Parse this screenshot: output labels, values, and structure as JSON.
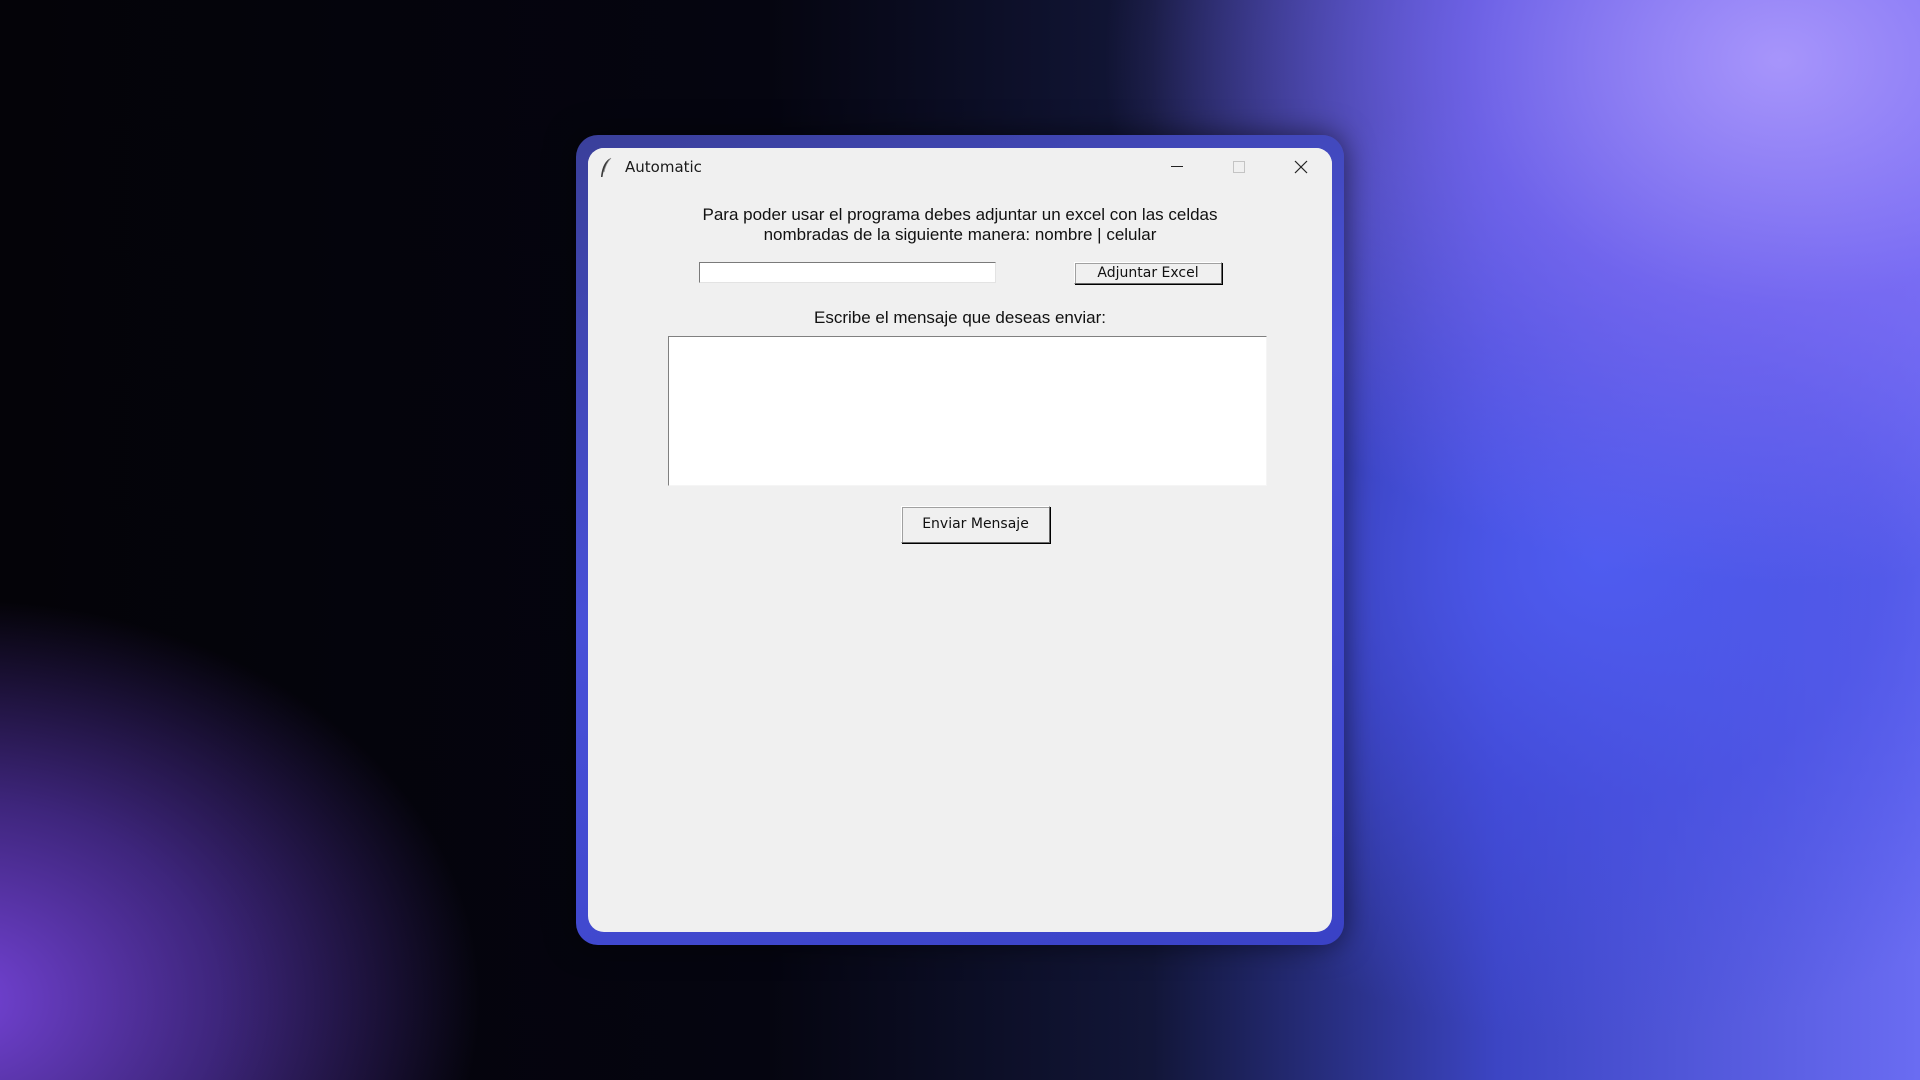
{
  "window": {
    "title": "Automatic",
    "app_icon": "feather-icon",
    "controls": {
      "minimize_icon": "minimize-icon",
      "maximize_icon": "maximize-icon",
      "close_icon": "close-icon"
    }
  },
  "form": {
    "instructions_line1": "Para poder usar el programa debes adjuntar un excel con las celdas",
    "instructions_line2": "nombradas de la siguiente manera: nombre | celular",
    "file_path_value": "",
    "attach_button_label": "Adjuntar Excel",
    "message_label": "Escribe el mensaje que deseas enviar:",
    "message_value": "",
    "send_button_label": "Enviar Mensaje"
  },
  "colors": {
    "window_background": "#f0f0f0",
    "desktop_accent_purple": "#a795fb",
    "desktop_accent_blue": "#4f5cf0"
  }
}
